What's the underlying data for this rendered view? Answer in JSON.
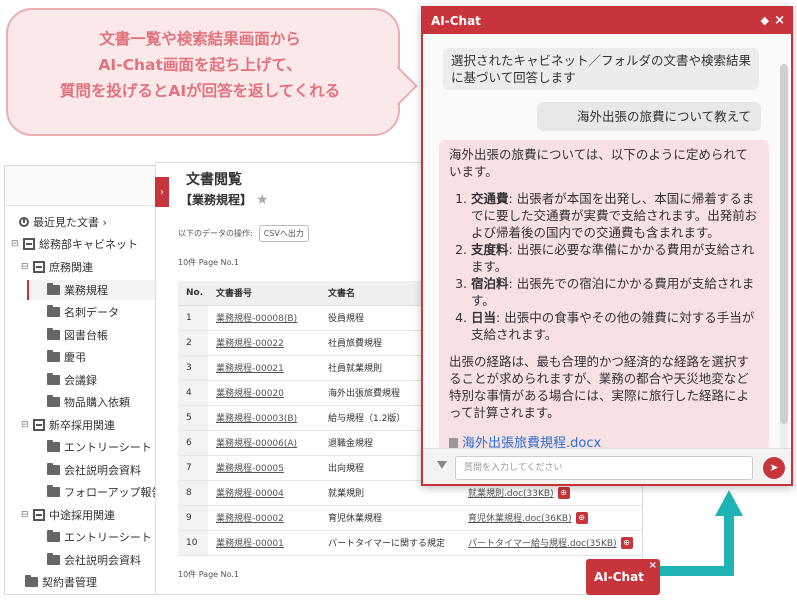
{
  "callout": {
    "lines": [
      "文書一覧や検索結果画面から",
      "AI-Chat画面を起ち上げて、",
      "質問を投げるとAIが回答を返してくれる"
    ]
  },
  "sidebar": {
    "recent_label": "最近見た文書 ›",
    "items": [
      {
        "label": "総務部キャビネット",
        "icon": "cabinet-icon",
        "toggle": "⊟"
      },
      {
        "label": "庶務関連",
        "icon": "cabinet-icon",
        "toggle": "⊟"
      },
      {
        "label": "業務規程",
        "icon": "folder-icon",
        "selected": true
      },
      {
        "label": "名刺データ",
        "icon": "folder-icon"
      },
      {
        "label": "図書台帳",
        "icon": "folder-icon"
      },
      {
        "label": "慶弔",
        "icon": "folder-icon"
      },
      {
        "label": "会議録",
        "icon": "folder-icon"
      },
      {
        "label": "物品購入依頼",
        "icon": "folder-icon"
      },
      {
        "label": "新卒採用関連",
        "icon": "cabinet-icon",
        "toggle": "⊟"
      },
      {
        "label": "エントリーシート",
        "icon": "folder-icon"
      },
      {
        "label": "会社説明会資料",
        "icon": "folder-icon"
      },
      {
        "label": "フォローアップ報告",
        "icon": "folder-icon"
      },
      {
        "label": "中途採用関連",
        "icon": "cabinet-icon",
        "toggle": "⊟"
      },
      {
        "label": "エントリーシート",
        "icon": "folder-icon"
      },
      {
        "label": "会社説明会資料",
        "icon": "folder-icon"
      },
      {
        "label": "契約書管理",
        "icon": "folder-icon"
      }
    ]
  },
  "main": {
    "title": "文書閲覧",
    "subtitle": "【業務規程】",
    "data_ops_label": "以下のデータの操作:",
    "csv_button": "CSVへ出力",
    "page_top": "10件 Page No.1",
    "page_bottom": "10件 Page No.1",
    "table": {
      "headers": [
        "No.",
        "文書番号",
        "文書名",
        ""
      ],
      "rows": [
        {
          "no": "1",
          "doc_id": "業務規程-00008(B)",
          "name": "役員規程",
          "file": ""
        },
        {
          "no": "2",
          "doc_id": "業務規程-00022",
          "name": "社員旅費規程",
          "file": ""
        },
        {
          "no": "3",
          "doc_id": "業務規程-00021",
          "name": "社員就業規則",
          "file": ""
        },
        {
          "no": "4",
          "doc_id": "業務規程-00020",
          "name": "海外出張旅費規程",
          "file": ""
        },
        {
          "no": "5",
          "doc_id": "業務規程-00003(B)",
          "name": "給与規程（1.2版）",
          "file": ""
        },
        {
          "no": "6",
          "doc_id": "業務規程-00006(A)",
          "name": "退職金規程",
          "file": ""
        },
        {
          "no": "7",
          "doc_id": "業務規程-00005",
          "name": "出向規程",
          "file": ""
        },
        {
          "no": "8",
          "doc_id": "業務規程-00004",
          "name": "就業規則",
          "file": "就業規則.doc(33KB)"
        },
        {
          "no": "9",
          "doc_id": "業務規程-00002",
          "name": "育児休業規程",
          "file": "育児休業規程.doc(36KB)"
        },
        {
          "no": "10",
          "doc_id": "業務規程-00001",
          "name": "パートタイマーに関する規定",
          "file": "パートタイマー給与規程.doc(35KB)"
        }
      ]
    }
  },
  "chat": {
    "title": "AI-Chat",
    "system_message": "選択されたキャビネット／フォルダの文書や検索結果に基づいて回答します",
    "user_message": "海外出張の旅費について教えて",
    "ai_intro": "海外出張の旅費については、以下のように定められています。",
    "ai_items": [
      {
        "term": "交通費",
        "text": ": 出張者が本国を出発し、本国に帰着するまでに要した交通費が実費で支給されます。出発前および帰着後の国内での交通費も含まれます。"
      },
      {
        "term": "支度料",
        "text": ": 出張に必要な準備にかかる費用が支給されます。"
      },
      {
        "term": "宿泊料",
        "text": ": 出張先での宿泊にかかる費用が支給されます。"
      },
      {
        "term": "日当",
        "text": ": 出張中の食事やその他の雑費に対する手当が支給されます。"
      }
    ],
    "ai_outro": "出張の経路は、最も合理的かつ経済的な経路を選択することが求められますが、業務の都合や天災地変など特別な事情がある場合には、実際に旅行した経路によって計算されます。",
    "attachment": "海外出張旅費規程.docx",
    "input_placeholder": "質問を入力してください"
  },
  "launcher": {
    "label": "AI-Chat",
    "close": "×"
  },
  "colors": {
    "accent": "#c8343b",
    "callout_text": "#e2737e",
    "arrow": "#1fb3b3"
  }
}
